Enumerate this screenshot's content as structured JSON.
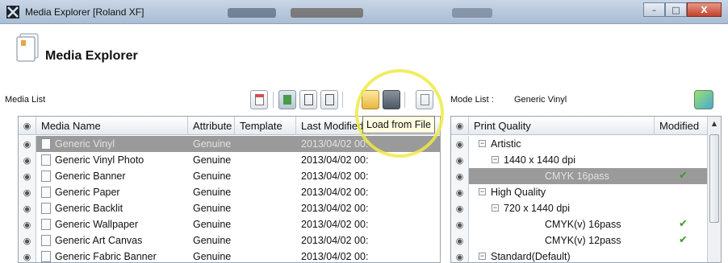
{
  "window": {
    "title": "Media Explorer [Roland XF]",
    "buttons": {
      "minimize": "–",
      "maximize": "□",
      "close": "X"
    }
  },
  "header": {
    "title": "Media Explorer",
    "icon": "document-stack-icon"
  },
  "media_list": {
    "label": "Media List",
    "toolbar": [
      "new-media-icon",
      "import-icon",
      "copy-icon",
      "print-icon",
      "load-from-file-icon",
      "export-icon",
      "delete-icon"
    ],
    "tooltip": "Load from File",
    "columns": [
      "Media Name",
      "Attribute",
      "Template",
      "Last Modified"
    ],
    "rows": [
      {
        "name": "Generic Vinyl",
        "attribute": "Genuine",
        "template": "",
        "modified": "2013/04/02 00:",
        "selected": true
      },
      {
        "name": "Generic Vinyl Photo",
        "attribute": "Genuine",
        "template": "",
        "modified": "2013/04/02 00:",
        "selected": false
      },
      {
        "name": "Generic Banner",
        "attribute": "Genuine",
        "template": "",
        "modified": "2013/04/02 00:",
        "selected": false
      },
      {
        "name": "Generic Paper",
        "attribute": "Genuine",
        "template": "",
        "modified": "2013/04/02 00:",
        "selected": false
      },
      {
        "name": "Generic Backlit",
        "attribute": "Genuine",
        "template": "",
        "modified": "2013/04/02 00:",
        "selected": false
      },
      {
        "name": "Generic Wallpaper",
        "attribute": "Genuine",
        "template": "",
        "modified": "2013/04/02 00:",
        "selected": false
      },
      {
        "name": "Generic Art Canvas",
        "attribute": "Genuine",
        "template": "",
        "modified": "2013/04/02 00:",
        "selected": false
      },
      {
        "name": "Generic Fabric Banner",
        "attribute": "Genuine",
        "template": "",
        "modified": "2013/04/02 00:",
        "selected": false
      }
    ]
  },
  "mode_list": {
    "label": "Mode List :",
    "value": "Generic Vinyl",
    "columns": [
      "Print Quality",
      "Modified"
    ],
    "rows": [
      {
        "label": "Artistic",
        "level": 0,
        "expander": "−",
        "modified": false,
        "selected": false
      },
      {
        "label": "1440 x 1440 dpi",
        "level": 1,
        "expander": "−",
        "modified": false,
        "selected": false
      },
      {
        "label": "CMYK 16pass",
        "level": 2,
        "expander": "",
        "modified": true,
        "selected": true
      },
      {
        "label": "High Quality",
        "level": 0,
        "expander": "−",
        "modified": false,
        "selected": false
      },
      {
        "label": "720 x 1440 dpi",
        "level": 1,
        "expander": "−",
        "modified": false,
        "selected": false
      },
      {
        "label": "CMYK(v) 16pass",
        "level": 2,
        "expander": "",
        "modified": true,
        "selected": false
      },
      {
        "label": "CMYK(v) 12pass",
        "level": 2,
        "expander": "",
        "modified": true,
        "selected": false
      },
      {
        "label": "Standard(Default)",
        "level": 0,
        "expander": "−",
        "modified": false,
        "selected": false
      }
    ]
  },
  "colors": {
    "selected_row": "#9a9a9a",
    "check": "#3f9a2a",
    "tooltip_bg": "#fffde1",
    "highlight": "#eeea46"
  }
}
